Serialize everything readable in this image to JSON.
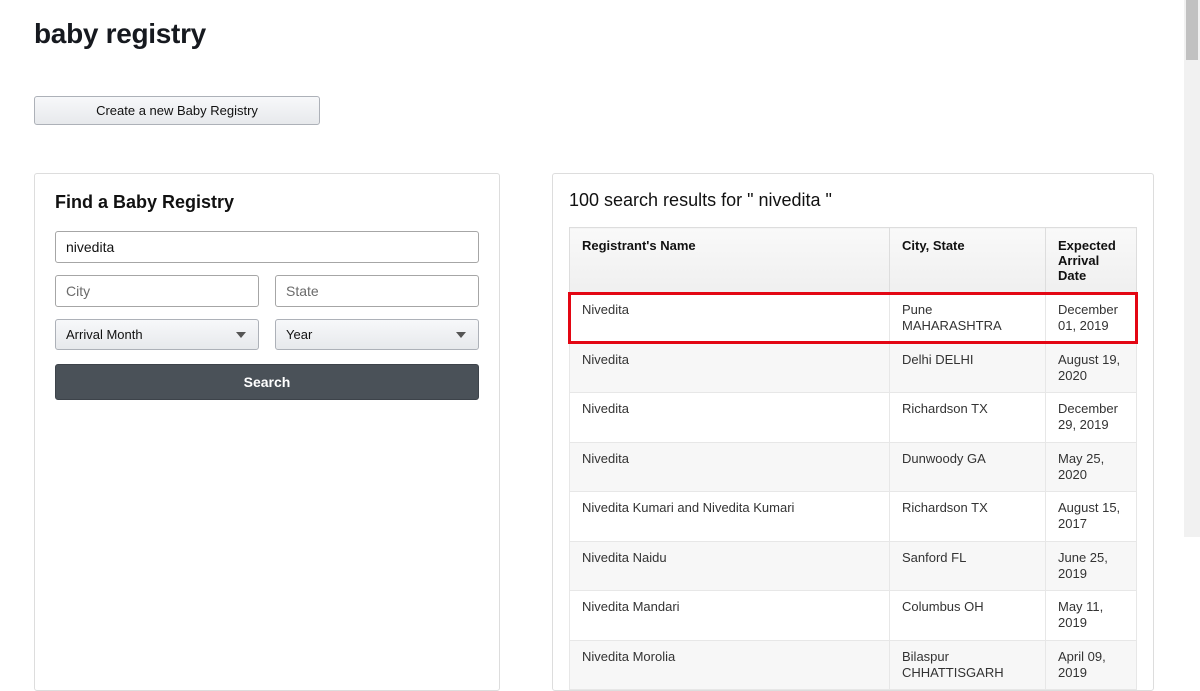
{
  "title": "baby registry",
  "create_button": "Create a new Baby Registry",
  "search_panel": {
    "heading": "Find a Baby Registry",
    "name_value": "nivedita",
    "city_placeholder": "City",
    "state_placeholder": "State",
    "month_label": "Arrival Month",
    "year_label": "Year",
    "search_button": "Search"
  },
  "results": {
    "heading": "100 search results for \" nivedita \"",
    "columns": {
      "name": "Registrant's Name",
      "city": "City, State",
      "date": "Expected Arrival Date"
    },
    "rows": [
      {
        "name": "Nivedita",
        "city": "Pune MAHARASHTRA",
        "date": "December 01, 2019",
        "highlighted": true
      },
      {
        "name": "Nivedita",
        "city": "Delhi DELHI",
        "date": "August 19, 2020"
      },
      {
        "name": "Nivedita",
        "city": "Richardson TX",
        "date": "December 29, 2019"
      },
      {
        "name": "Nivedita",
        "city": "Dunwoody GA",
        "date": "May 25, 2020"
      },
      {
        "name": "Nivedita Kumari and Nivedita Kumari",
        "city": "Richardson TX",
        "date": "August 15, 2017"
      },
      {
        "name": "Nivedita Naidu",
        "city": "Sanford FL",
        "date": "June 25, 2019"
      },
      {
        "name": "Nivedita Mandari",
        "city": "Columbus OH",
        "date": "May 11, 2019"
      },
      {
        "name": "Nivedita Morolia",
        "city": "Bilaspur CHHATTISGARH",
        "date": "April 09, 2019"
      }
    ]
  }
}
